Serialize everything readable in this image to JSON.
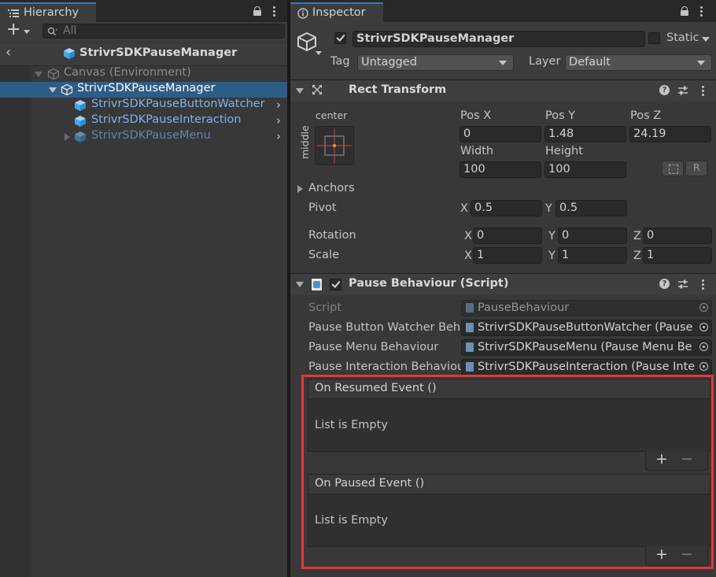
{
  "hierarchy": {
    "tab_label": "Hierarchy",
    "search_placeholder": "All",
    "scene_title": "StrivrSDKPauseManager",
    "items": [
      {
        "label": "Canvas (Environment)"
      },
      {
        "label": "StrivrSDKPauseManager"
      },
      {
        "label": "StrivrSDKPauseButtonWatcher"
      },
      {
        "label": "StrivrSDKPauseInteraction"
      },
      {
        "label": "StrivrSDKPauseMenu"
      }
    ]
  },
  "inspector": {
    "tab_label": "Inspector",
    "object_name": "StrivrSDKPauseManager",
    "static_label": "Static",
    "tag_label": "Tag",
    "tag_value": "Untagged",
    "layer_label": "Layer",
    "layer_value": "Default",
    "rect_transform": {
      "title": "Rect Transform",
      "anchor_h": "center",
      "anchor_v": "middle",
      "pos_x_label": "Pos X",
      "pos_x": "0",
      "pos_y_label": "Pos Y",
      "pos_y": "1.48",
      "pos_z_label": "Pos Z",
      "pos_z": "24.19",
      "width_label": "Width",
      "width": "100",
      "height_label": "Height",
      "height": "100",
      "anchors_label": "Anchors",
      "pivot_label": "Pivot",
      "pivot_x": "0.5",
      "pivot_y": "0.5",
      "rotation_label": "Rotation",
      "rot_x": "0",
      "rot_y": "0",
      "rot_z": "0",
      "scale_label": "Scale",
      "scale_x": "1",
      "scale_y": "1",
      "scale_z": "1",
      "x": "X",
      "y": "Y",
      "z": "Z",
      "blueprint_btn": "⬚",
      "raw_btn": "R"
    },
    "pause_behaviour": {
      "title": "Pause Behaviour (Script)",
      "script_label": "Script",
      "script_value": "PauseBehaviour",
      "watcher_label": "Pause Button Watcher Beh",
      "watcher_value": "StrivrSDKPauseButtonWatcher (Pause",
      "menu_label": "Pause Menu Behaviour",
      "menu_value": "StrivrSDKPauseMenu (Pause Menu Be",
      "interaction_label": "Pause Interaction Behaviou",
      "interaction_value": "StrivrSDKPauseInteraction (Pause Inte",
      "resumed_title": "On Resumed Event ()",
      "resumed_empty": "List is Empty",
      "paused_title": "On Paused Event ()",
      "paused_empty": "List is Empty",
      "add": "+",
      "remove": "−"
    }
  },
  "colors": {
    "selection": "#2c5d87",
    "highlight_border": "#e03a3a",
    "link_blue": "#7cb4ef"
  }
}
